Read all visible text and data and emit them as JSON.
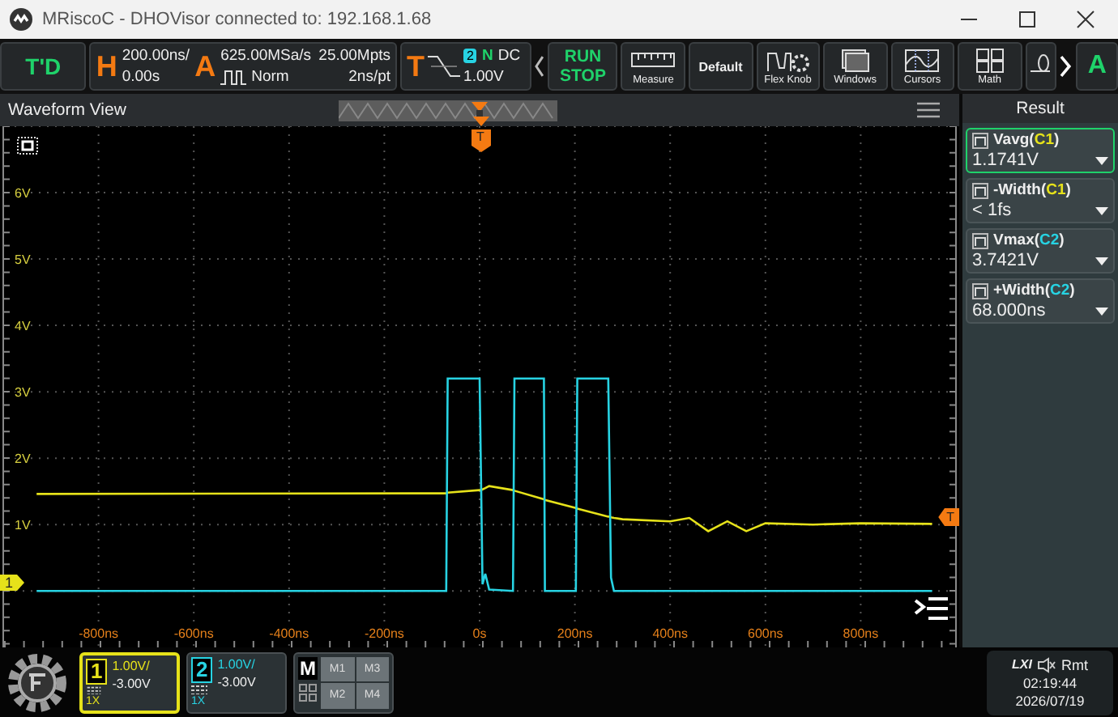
{
  "window": {
    "title": "MRiscoC - DHOVisor connected to: 192.168.1.68"
  },
  "toolbar": {
    "mode": "T'D",
    "horizontal": {
      "letter": "H",
      "timebase": "200.00ns/",
      "offset": "0.00s"
    },
    "acquire": {
      "letter": "A",
      "sample_rate": "625.00MSa/s",
      "memory": "25.00Mpts",
      "mode": "Norm",
      "resolution": "2ns/pt"
    },
    "trigger": {
      "letter": "T",
      "source": "2",
      "sweep": "N",
      "coupling": "DC",
      "level": "1.00V"
    },
    "run": "RUN",
    "stop": "STOP",
    "buttons": [
      {
        "kind": "ruler",
        "label": "Measure"
      },
      {
        "kind": "text",
        "label": "Default"
      },
      {
        "kind": "knob",
        "label": "Flex Knob"
      },
      {
        "kind": "windows",
        "label": "Windows"
      },
      {
        "kind": "cursors",
        "label": "Cursors"
      },
      {
        "kind": "math",
        "label": "Math"
      }
    ],
    "auto": "A"
  },
  "waveform_view": {
    "title": "Waveform View",
    "chart_data": {
      "type": "line",
      "grid": true,
      "xlim": [
        -1000,
        1000
      ],
      "ylim": [
        -0.85,
        7
      ],
      "x": [
        -930,
        -70,
        -67,
        0,
        3,
        6,
        12,
        20,
        70,
        73,
        135,
        137,
        202,
        205,
        270,
        273,
        276,
        282,
        300,
        400,
        440,
        480,
        520,
        560,
        600,
        700,
        800,
        950
      ],
      "series": [
        {
          "color": "#e6e21a",
          "values": [
            1.46,
            1.47,
            1.48,
            1.52,
            1.52,
            1.53,
            1.55,
            1.58,
            1.52,
            1.51,
            1.38,
            1.37,
            1.25,
            1.24,
            1.12,
            1.12,
            1.11,
            1.1,
            1.08,
            1.05,
            1.1,
            0.9,
            1.05,
            0.9,
            1.02,
            1.0,
            1.02,
            1.01
          ]
        },
        {
          "color": "#27d3e3",
          "values": [
            0,
            0,
            3.2,
            3.2,
            null,
            0.1,
            0.26,
            0.02,
            0,
            3.2,
            3.2,
            0,
            0,
            3.2,
            3.2,
            null,
            0.2,
            0,
            0,
            0,
            0,
            0,
            0,
            0,
            0,
            0,
            0,
            0
          ]
        }
      ],
      "yticks": [
        {
          "value": 6,
          "label": "6V"
        },
        {
          "value": 5,
          "label": "5V"
        },
        {
          "value": 4,
          "label": "4V"
        },
        {
          "value": 3,
          "label": "3V"
        },
        {
          "value": 2,
          "label": "2V"
        },
        {
          "value": 1,
          "label": "1V"
        }
      ],
      "xticks": [
        {
          "value": -800,
          "label": "-800ns"
        },
        {
          "value": -600,
          "label": "-600ns"
        },
        {
          "value": -400,
          "label": "-400ns"
        },
        {
          "value": -200,
          "label": "-200ns"
        },
        {
          "value": 0,
          "label": "0s"
        },
        {
          "value": 200,
          "label": "200ns"
        },
        {
          "value": 400,
          "label": "400ns"
        },
        {
          "value": 600,
          "label": "600ns"
        },
        {
          "value": 800,
          "label": "800ns"
        }
      ]
    },
    "trigger_marker": "T",
    "trigger_level_marker": "T",
    "channel_marker": "1"
  },
  "result": {
    "title": "Result",
    "measurements": [
      {
        "prefix": "Vavg(",
        "channel": "C1",
        "suffix": ")",
        "value": "1.1741V",
        "color": "#e6e21a",
        "selected": true
      },
      {
        "prefix": "-Width(",
        "channel": "C1",
        "suffix": ")",
        "value": "< 1fs",
        "color": "#e6e21a",
        "selected": false
      },
      {
        "prefix": "Vmax(",
        "channel": "C2",
        "suffix": ")",
        "value": "3.7421V",
        "color": "#27d3e3",
        "selected": false
      },
      {
        "prefix": "+Width(",
        "channel": "C2",
        "suffix": ")",
        "value": "68.000ns",
        "color": "#27d3e3",
        "selected": false
      }
    ]
  },
  "channels": [
    {
      "number": "1",
      "scale": "1.00V/",
      "offset": "-3.00V",
      "probe": "1X",
      "color": "#e6e21a",
      "selected": true
    },
    {
      "number": "2",
      "scale": "1.00V/",
      "offset": "-3.00V",
      "probe": "1X",
      "color": "#27d3e3",
      "selected": false
    }
  ],
  "math": {
    "letter": "M",
    "slots": [
      "M1",
      "M3",
      "M2",
      "M4"
    ]
  },
  "status": {
    "lxi": "LXI",
    "remote": "Rmt",
    "time": "02:19:44",
    "date": "2026/07/19"
  }
}
